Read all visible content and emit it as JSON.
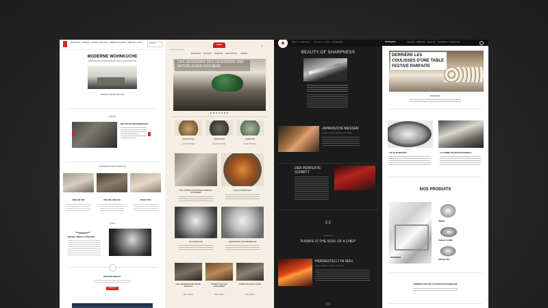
{
  "colors": {
    "bg": "#262626",
    "accent_red": "#d9261c",
    "cream": "#f4efe4",
    "dark": "#1b1b1b"
  },
  "panel1": {
    "nav_items": [
      "PRODUKTE",
      "MARKEN",
      "KOCHEN",
      "ZWILLING",
      "REZEPTE",
      "MAGAZIN",
      "SERVICE",
      "SHOP"
    ],
    "search_label": "SUCHE",
    "hero_title": "MODERNE WOHNKÜCHE",
    "hero_subtitle": "SPEZIALISTIN FÜR INTERNATIONALE WOHNKULTUR",
    "btn_quality": "WOHNKÜCHE DIE QUALITÄT",
    "section_made": "MADE IN",
    "feature_title": "DEUTSCHE MESSERKUNST",
    "section_designs": "AUSGEZEICHNETE DESIGNS",
    "card1": "ZWILLING PRO",
    "card2": "ZWILLING ZWILLING",
    "card3": "FRANK TOTH",
    "section_chefs": "CHEFS",
    "chef_title": "DESIGN TRIFFT FUNKTION",
    "newsletter": "PRODUKTINFOS?",
    "newsletter_btn": "ANMELDEN"
  },
  "panel2": {
    "logo": "staub",
    "nav_items": [
      "PRODUKTE",
      "KOCHEN",
      "REZEPTE",
      "GESCHICHTE",
      "STORES"
    ],
    "hero_title": "DAS GEHEIMNIS DES GESUNDEN UND NATÜRLICHEN KOCHENS",
    "products": [
      {
        "name": "BAGUETTES",
        "btn": "Zu den Produkten"
      },
      {
        "name": "VARIANTEN",
        "btn": "Zu den Produkten"
      },
      {
        "name": "ZUBEHÖR",
        "btn": "Zu den Produkten"
      }
    ],
    "feature1_title": "DIE VORTEILE VON EMAILLIERTEM GUSSEISEN",
    "feature2_title": "COQ AU RIEPOURS",
    "chef1": "PAUL BOCUSE",
    "chef2": "VERWANDTE KOCHBEREICHE",
    "bottom1": "DAS GEHEIMNIS DES STAUB-DECKELS",
    "bottom2": "PRODUKTION UND HANDARBEIT",
    "bottom3": "ROMANTIK MACHT SINNE",
    "more": "Mehr erfahren"
  },
  "panel3": {
    "nav_items": [
      "BEAUTY OF SHARPNESS",
      "PRODUKTE",
      "KOCHEN",
      "UNTERNEHMEN"
    ],
    "hero_title": "BEAUTY OF SHARPNESS",
    "section1": "JAPANISCHE MESSER",
    "section1_sub": "SCHARF, WIE NUR JAPANISCHE KLINGEN",
    "section2": "DER PERFEKTE SCHNITT",
    "quote_mark": "“",
    "quote_small": "IM HANDWERK",
    "quote": "\"A KNIFE IS THE SOUL OF A CHEF\"",
    "section3": "HERGESTELLT IN SEKI",
    "section3_sub": "JAPAN, GEFERTIGT IN SEIT 1731 IN SEKI"
  },
  "panel4": {
    "logo": "demeyere",
    "nav_items": [
      "PRODUITS",
      "DEMEYERE",
      "RECETTES",
      "SPÉCIALITÉS",
      "TECHNOLOGIE"
    ],
    "hero_line1": "DERRIÈRE LES",
    "hero_line2": "COULISSES D'UNE TABLE",
    "hero_line3": "FESTIVE PARFAITE",
    "hero_caption": "BIENVENUE",
    "feature_left": "\"BLUE IN MESSEN\"",
    "feature_right": "LA GAMME DE PROFESSIONNELS",
    "products_title": "NOS PRODUITS",
    "cat1": "SÉRIES",
    "cat2": "POÊLES À FRIRE",
    "cat3": "SPÉCIALITÉS",
    "cat4": "RÉCIPIENTS",
    "bottom_title": "COMMENT TROUVER LES PRODUITS DE DEMEYERE"
  }
}
